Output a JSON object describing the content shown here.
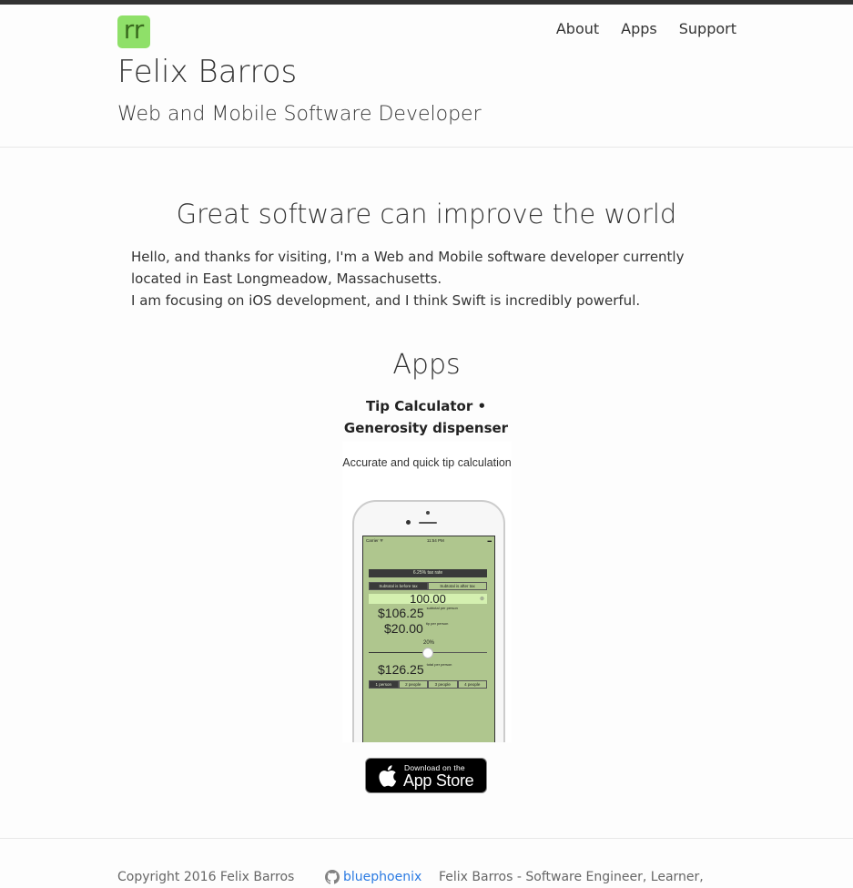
{
  "header": {
    "logo_text": "rr",
    "title": "Felix Barros",
    "subtitle": "Web and Mobile Software Developer",
    "nav": [
      {
        "label": "About"
      },
      {
        "label": "Apps"
      },
      {
        "label": "Support"
      }
    ]
  },
  "colors": {
    "logo_bg": "#8fe069",
    "link": "#2a7ae2",
    "app_screen_bg": "#afc68e"
  },
  "main": {
    "heading": "Great software can improve the world",
    "intro_lines": [
      "Hello, and thanks for visiting, I'm a Web and Mobile software developer currently located in East Longmeadow, Massachusetts.",
      "I am focusing on iOS development, and I think Swift is incredibly powerful."
    ]
  },
  "apps": {
    "heading": "Apps",
    "app_name_line1": "Tip Calculator •",
    "app_name_line2": "Generosity dispenser",
    "screenshot": {
      "caption": "Accurate and quick tip calculation",
      "status_carrier": "Carrier ᯤ",
      "status_time": "11:54 PM",
      "status_battery": "▬",
      "tax_rate": "6.25% tax rate",
      "segments_tax": [
        "Subtotal is before tax",
        "Subtotal is after tax"
      ],
      "amount": "100.00",
      "subtotal_value": "$106.25",
      "subtotal_label": "subtotal per person",
      "tip_value": "$20.00",
      "tip_label": "tip per person",
      "tip_percent": "20%",
      "tip_slider_fraction": 0.5,
      "total_value": "$126.25",
      "total_label": "total per person",
      "segments_people": [
        "1 person",
        "2 people",
        "3 people",
        "4 people"
      ]
    },
    "appstore_small": "Download on the",
    "appstore_big": "App Store"
  },
  "footer": {
    "copyright": "Copyright 2016 Felix Barros",
    "github_user": "bluephoenix",
    "tagline": "Felix Barros - Software Engineer, Learner,"
  }
}
